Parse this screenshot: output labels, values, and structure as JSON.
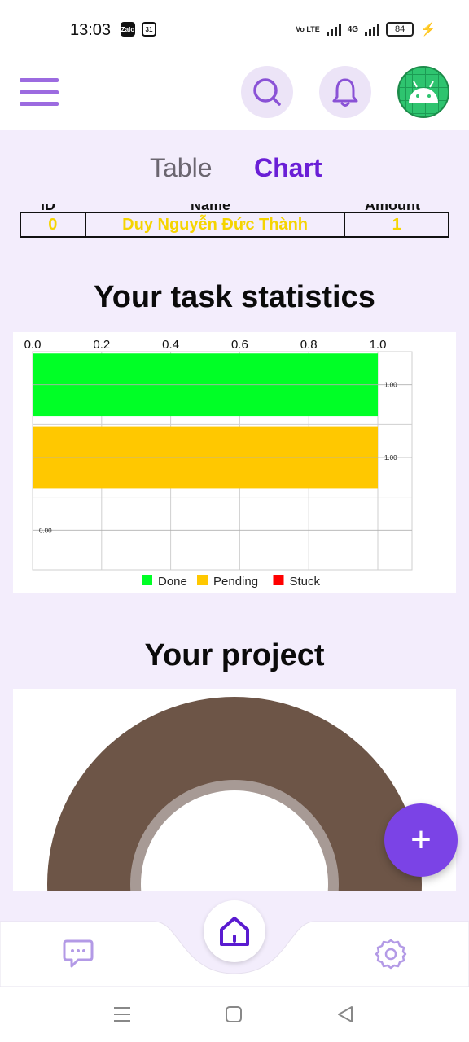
{
  "status_bar": {
    "time": "13:03",
    "badge1": "Zalo",
    "badge2": "31",
    "network": "4G",
    "volte": "Vo LTE",
    "battery": "84"
  },
  "header": {
    "menu_icon": "hamburger-menu-icon",
    "search_icon": "search-icon",
    "bell_icon": "bell-icon",
    "avatar_icon": "android-avatar-icon"
  },
  "tabs": [
    {
      "label": "Table"
    },
    {
      "label": "Chart"
    }
  ],
  "table": {
    "headers": [
      "ID",
      "Name",
      "Amount"
    ],
    "rows": [
      {
        "id": "0",
        "name": "Duy Nguyễn Đức Thành",
        "amount": "1"
      }
    ]
  },
  "task_stats": {
    "title": "Your task statistics"
  },
  "chart_data": {
    "type": "bar",
    "orientation": "horizontal",
    "categories": [
      "Done",
      "Pending",
      "Stuck"
    ],
    "values": [
      1.0,
      1.0,
      0.0
    ],
    "value_labels": [
      "1.00",
      "1.00",
      "0.00"
    ],
    "xlim": [
      0,
      1.0
    ],
    "x_ticks": [
      "0.0",
      "0.2",
      "0.4",
      "0.6",
      "0.8",
      "1.0"
    ],
    "legend": [
      {
        "name": "Done",
        "color": "#00ff26"
      },
      {
        "name": "Pending",
        "color": "#ffc800"
      },
      {
        "name": "Stuck",
        "color": "#ff0000"
      }
    ],
    "legend_position": "bottom",
    "grid": true
  },
  "project": {
    "title": "Your project",
    "donut_color": "#6d5547",
    "inner_ring_color": "#a79a95"
  },
  "fab": {
    "label": "+"
  },
  "bottom_nav": {
    "chat_icon": "chat-icon",
    "home_icon": "home-icon",
    "settings_icon": "gear-icon"
  },
  "colors": {
    "accent": "#6a1fd6",
    "background": "#f3edfc"
  }
}
